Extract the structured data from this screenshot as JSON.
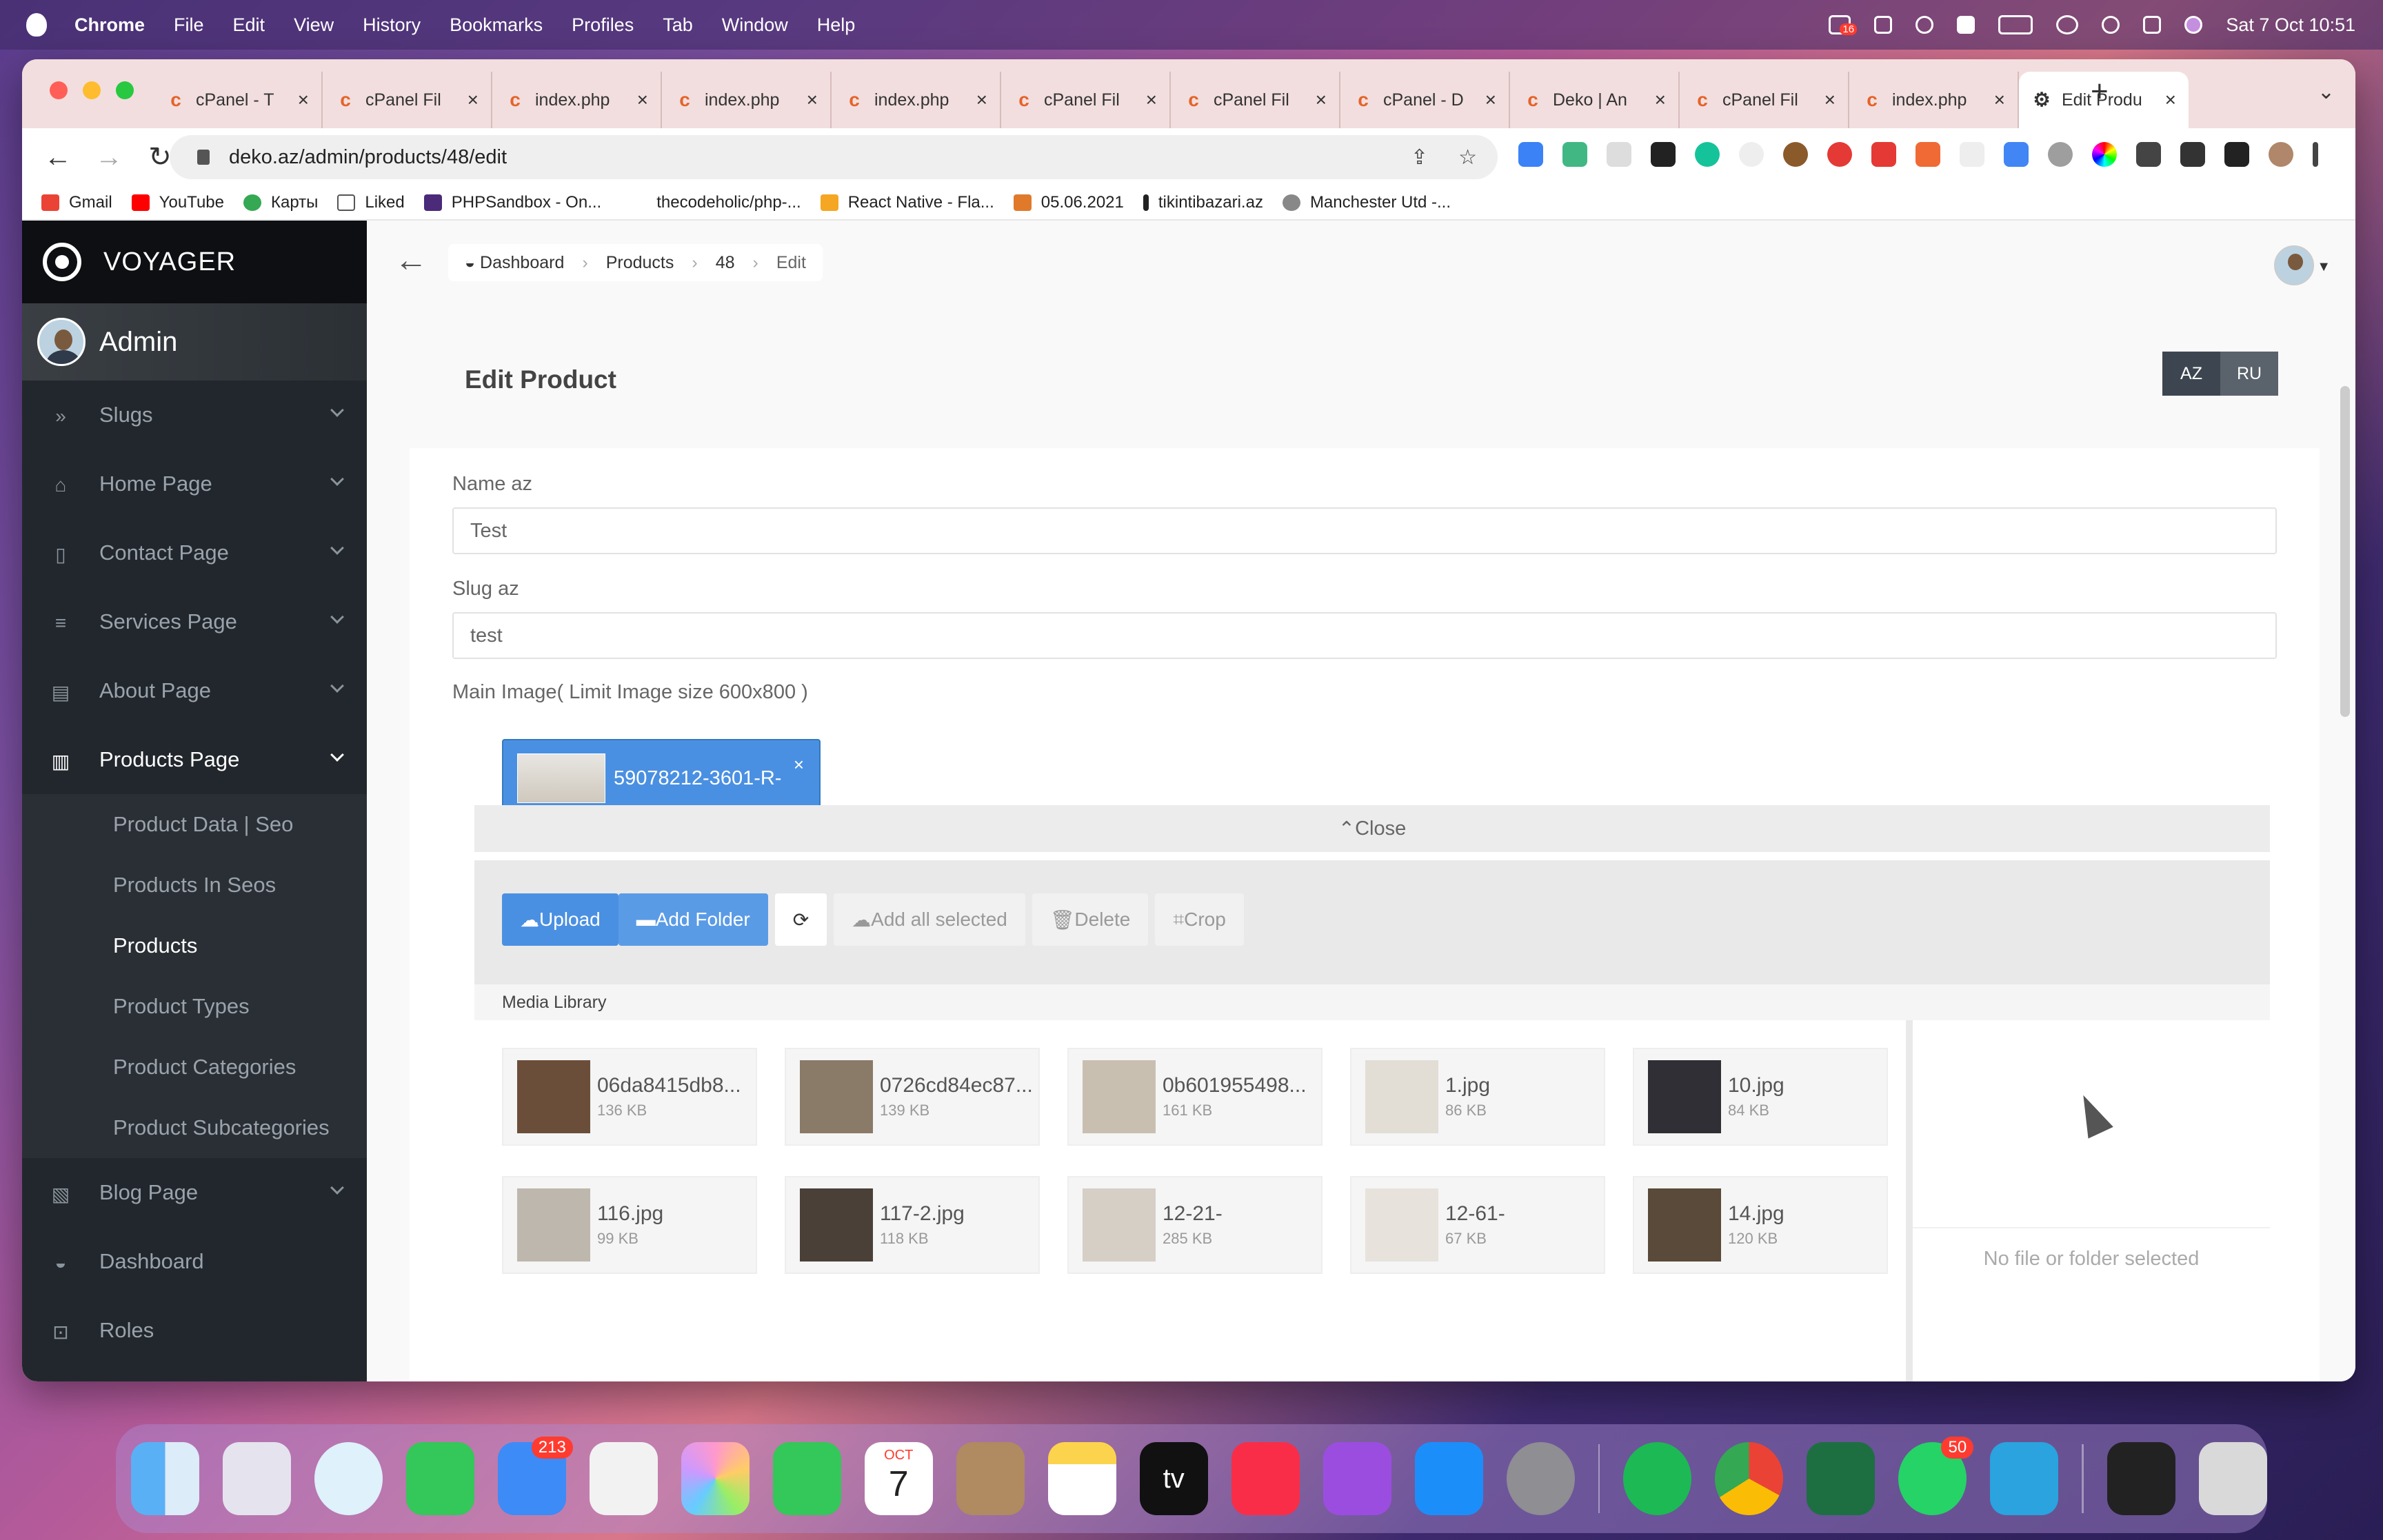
{
  "menubar": {
    "app": "Chrome",
    "items": [
      "File",
      "Edit",
      "View",
      "History",
      "Bookmarks",
      "Profiles",
      "Tab",
      "Window",
      "Help"
    ],
    "clock": "Sat 7 Oct  10:51",
    "notif_badge": "16"
  },
  "tabs": [
    {
      "title": "cPanel - T"
    },
    {
      "title": "cPanel Fil"
    },
    {
      "title": "index.php"
    },
    {
      "title": "index.php"
    },
    {
      "title": "index.php"
    },
    {
      "title": "cPanel Fil"
    },
    {
      "title": "cPanel Fil"
    },
    {
      "title": "cPanel - D"
    },
    {
      "title": "Deko | An"
    },
    {
      "title": "cPanel Fil"
    },
    {
      "title": "index.php"
    },
    {
      "title": "Edit Produ"
    }
  ],
  "address": {
    "url": "deko.az/admin/products/48/edit"
  },
  "bookmarks": [
    "Gmail",
    "YouTube",
    "Карты",
    "Liked",
    "PHPSandbox - On...",
    "thecodeholic/php-...",
    "React Native - Fla...",
    "05.06.2021",
    "tikintibazari.az",
    "Manchester Utd -..."
  ],
  "sidebar": {
    "brand": "VOYAGER",
    "user": "Admin",
    "items": [
      {
        "label": "Slugs",
        "icon": "»"
      },
      {
        "label": "Home Page",
        "icon": "⌂"
      },
      {
        "label": "Contact Page",
        "icon": "▯"
      },
      {
        "label": "Services Page",
        "icon": "≡"
      },
      {
        "label": "About Page",
        "icon": "▤"
      },
      {
        "label": "Products Page",
        "icon": "▥"
      }
    ],
    "subitems": [
      "Product Data | Seo",
      "Products In Seos",
      "Products",
      "Product Types",
      "Product Categories",
      "Product Subcategories"
    ],
    "items_after": [
      {
        "label": "Blog Page",
        "icon": "▧"
      },
      {
        "label": "Dashboard",
        "icon": "◒"
      },
      {
        "label": "Roles",
        "icon": "⊡"
      }
    ]
  },
  "breadcrumb": {
    "home": "Dashboard",
    "products": "Products",
    "id": "48",
    "edit": "Edit"
  },
  "page": {
    "title": "Edit Product",
    "lang_az": "AZ",
    "lang_ru": "RU"
  },
  "form": {
    "name_label": "Name az",
    "name_value": "Test",
    "slug_label": "Slug az",
    "slug_value": "test",
    "image_label": "Main Image( Limit Image size 600x800 )",
    "chip_name": "59078212-3601-R-",
    "chip_close": "×",
    "close_label": "Close"
  },
  "media": {
    "upload": "Upload",
    "add_folder": "Add Folder",
    "refresh": "⟳",
    "add_all": "Add all selected",
    "delete": "Delete",
    "crop": "Crop",
    "library": "Media Library",
    "no_file": "No file or folder selected",
    "files": [
      {
        "name": "06da8415db8...",
        "size": "136 KB"
      },
      {
        "name": "0726cd84ec87...",
        "size": "139 KB"
      },
      {
        "name": "0b601955498...",
        "size": "161 KB"
      },
      {
        "name": "1.jpg",
        "size": "86 KB"
      },
      {
        "name": "10.jpg",
        "size": "84 KB"
      },
      {
        "name": "116.jpg",
        "size": "99 KB"
      },
      {
        "name": "117-2.jpg",
        "size": "118 KB"
      },
      {
        "name": "12-21-",
        "size": "285 KB"
      },
      {
        "name": "12-61-",
        "size": "67 KB"
      },
      {
        "name": "14.jpg",
        "size": "120 KB"
      }
    ]
  },
  "dock": {
    "mail_badge": "213",
    "whatsapp_badge": "50",
    "calendar_month": "OCT",
    "calendar_day": "7",
    "tv_label": "tv"
  },
  "colors": {
    "voyager_blue": "#4a90e2",
    "sidebar": "#22272d",
    "lang_active": "#3d4650",
    "lang_inactive": "#5a626b"
  }
}
